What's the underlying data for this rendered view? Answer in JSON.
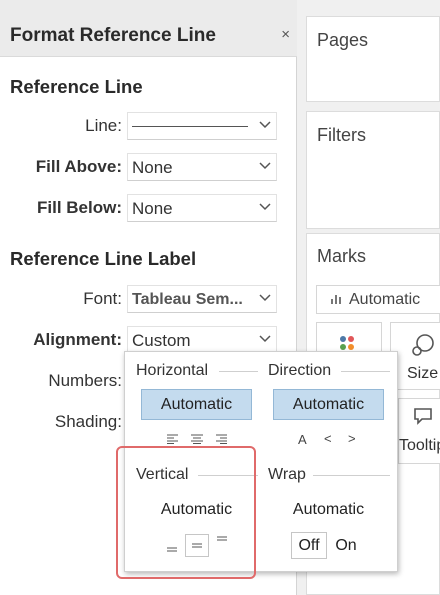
{
  "panel": {
    "title": "Format Reference Line",
    "close_glyph": "×"
  },
  "reference_line": {
    "heading": "Reference Line",
    "line_label": "Line:",
    "fill_above_label": "Fill Above:",
    "fill_above_value": "None",
    "fill_below_label": "Fill Below:",
    "fill_below_value": "None"
  },
  "reference_line_label": {
    "heading": "Reference Line Label",
    "font_label": "Font:",
    "font_value": "Tableau Sem...",
    "alignment_label": "Alignment:",
    "alignment_value": "Custom",
    "numbers_label": "Numbers:",
    "shading_label": "Shading:"
  },
  "sidebar": {
    "pages_title": "Pages",
    "filters_title": "Filters",
    "marks_title": "Marks",
    "marks_type": "Automatic",
    "size_label": "Size",
    "tooltip_label": "Tooltip"
  },
  "alignment_popup": {
    "horizontal_label": "Horizontal",
    "horizontal_value": "Automatic",
    "direction_label": "Direction",
    "direction_value": "Automatic",
    "direction_icons": [
      "A",
      "<",
      ">"
    ],
    "vertical_label": "Vertical",
    "vertical_value": "Automatic",
    "wrap_label": "Wrap",
    "wrap_value": "Automatic",
    "wrap_off": "Off",
    "wrap_on": "On"
  },
  "colors": {
    "selected_fill": "#c4dbee",
    "highlight": "#e06a6a"
  }
}
